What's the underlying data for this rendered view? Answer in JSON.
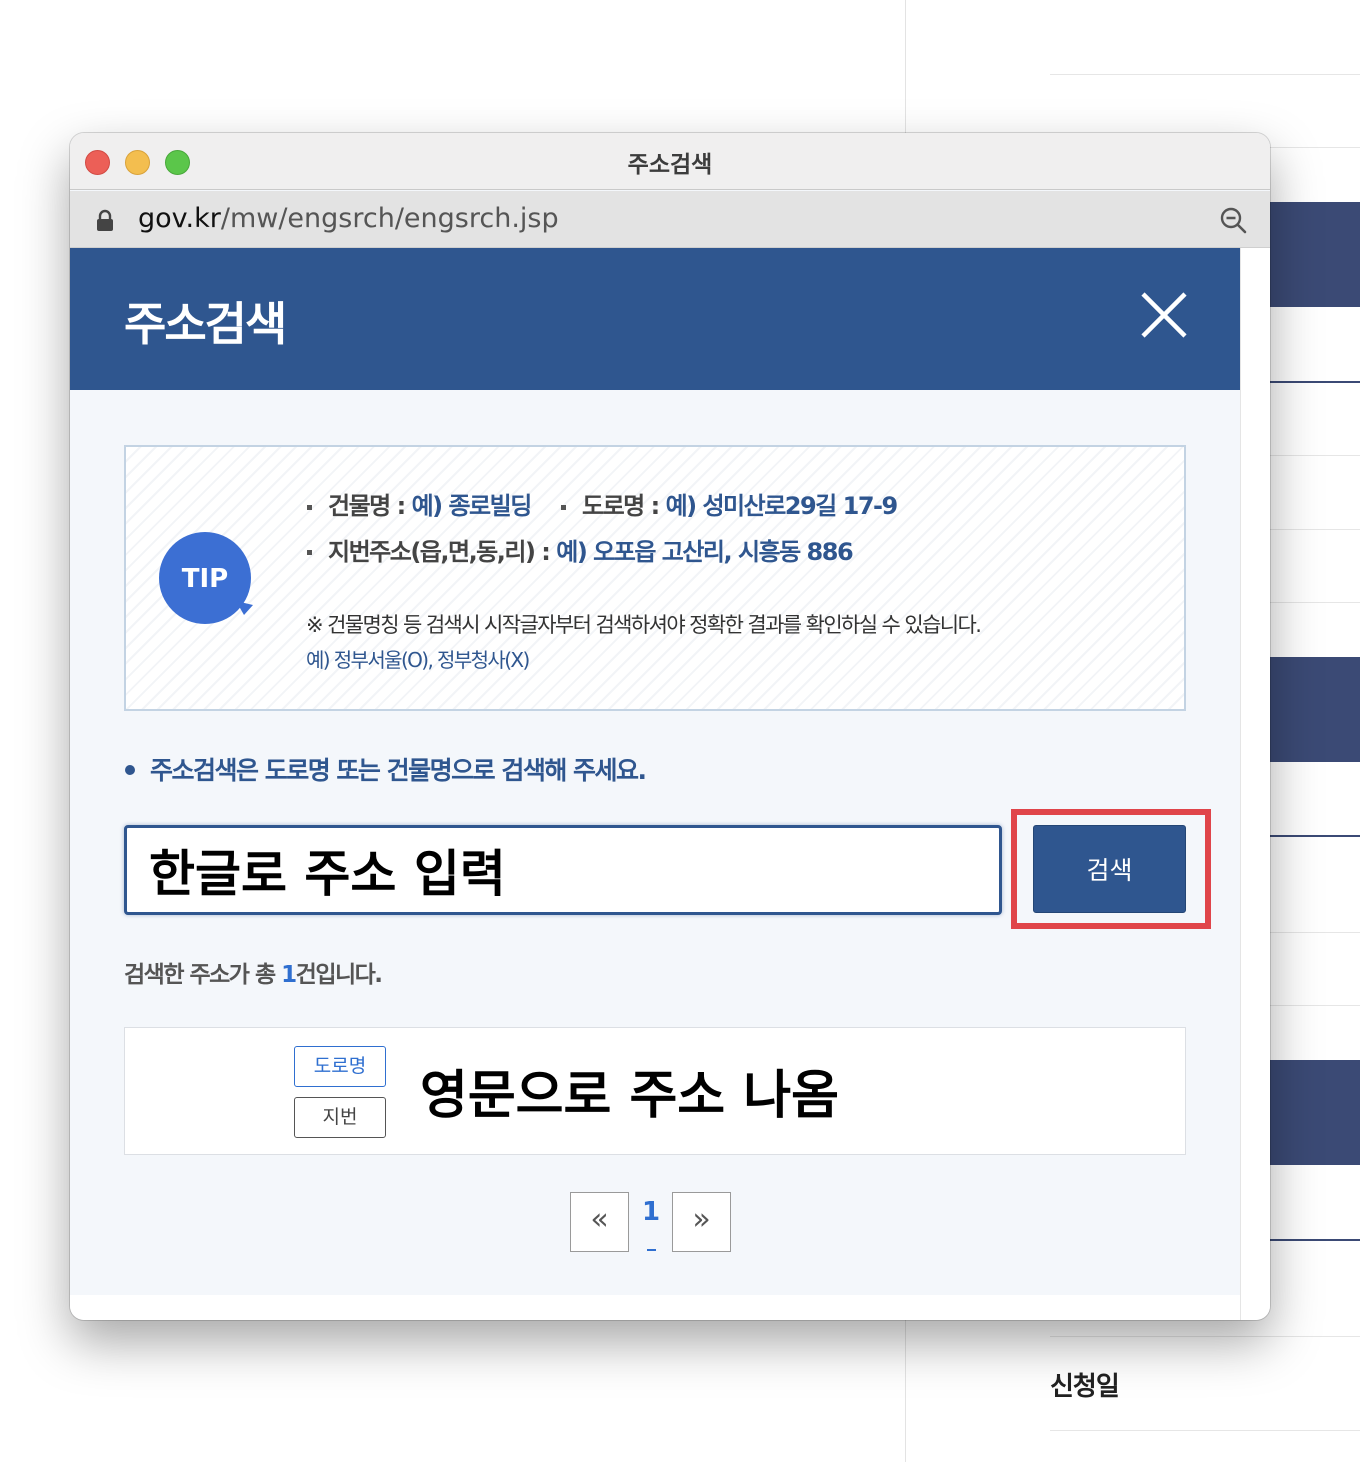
{
  "window": {
    "title": "주소검색",
    "url_host": "gov.kr",
    "url_path": "/mw/engsrch/engsrch.jsp"
  },
  "modal": {
    "title": "주소검색",
    "close_icon": "close-icon"
  },
  "tip": {
    "badge": "TIP",
    "building_label": "건물명 : ",
    "building_example": "예) 종로빌딩",
    "road_label": "도로명 : ",
    "road_example": "예) 성미산로29길 17-9",
    "lot_label": "지번주소(읍,면,동,리) : ",
    "lot_example": "예) 오포읍 고산리, 시흥동 886",
    "note": "※ 건물명칭 등 검색시 시작글자부터 검색하셔야 정확한 결과를 확인하실 수 있습니다.",
    "note_example": "예) 정부서울(O), 정부청사(X)"
  },
  "guide": "주소검색은 도로명 또는 건물명으로 검색해 주세요.",
  "search": {
    "value": "한글로 주소 입력",
    "button_label": "검색"
  },
  "results": {
    "count_prefix": "검색한 주소가 총 ",
    "count": "1",
    "count_suffix": "건입니다.",
    "tag_road": "도로명",
    "tag_lot": "지번",
    "address": "영문으로 주소 나옴"
  },
  "pagination": {
    "prev": "«",
    "current": "1",
    "next": "»"
  },
  "background": {
    "label": "신청일"
  },
  "colors": {
    "primary": "#2f568f",
    "link_blue": "#2f6fd0",
    "highlight_red": "#e0454a"
  }
}
